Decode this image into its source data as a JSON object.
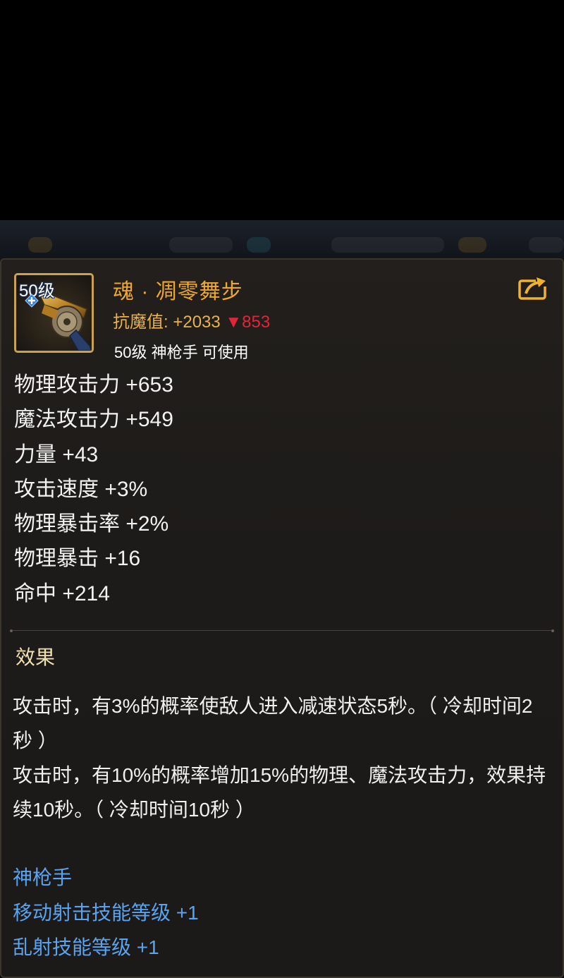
{
  "item": {
    "level_badge": "50级",
    "name": "魂 · 凋零舞步",
    "resist_label": "抗魔值:",
    "resist_value": "+2033",
    "resist_down": "▼853",
    "requirement": "50级 神枪手 可使用"
  },
  "stats": [
    "物理攻击力 +653",
    "魔法攻击力 +549",
    "力量 +43",
    "攻击速度 +3%",
    "物理暴击率 +2%",
    "物理暴击 +16",
    "命中 +214"
  ],
  "effect": {
    "title": "效果",
    "lines": [
      "攻击时，有3%的概率使敌人进入减速状态5秒。（ 冷却时间2秒 ）",
      "攻击时，有10%的概率增加15%的物理、魔法攻击力，效果持续10秒。（ 冷却时间10秒 ）"
    ]
  },
  "class_bonus": {
    "class_name": "神枪手",
    "skills": [
      "移动射击技能等级 +1",
      "乱射技能等级 +1"
    ]
  },
  "colors": {
    "name": "#f0a82c",
    "resist": "#e9b24a",
    "down": "#e0263a",
    "bonus": "#5aa3ef",
    "frame": "#c9a24f"
  },
  "icons": {
    "item_icon": "revolver-icon",
    "share": "share-arrow-icon",
    "upgrade": "plus-icon"
  }
}
